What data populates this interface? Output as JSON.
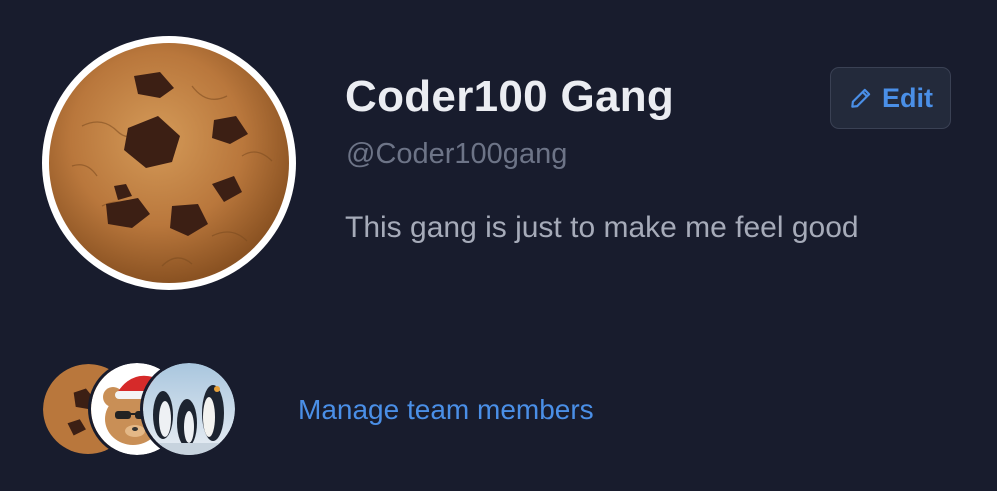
{
  "team": {
    "name": "Coder100 Gang",
    "handle": "@Coder100gang",
    "bio": "This gang is just to make me feel good",
    "avatar_icon": "cookie-image"
  },
  "edit_button": {
    "label": "Edit",
    "icon": "pencil-icon"
  },
  "members": [
    {
      "avatar": "cookie-image"
    },
    {
      "avatar": "bear-with-santa-hat-and-sunglasses-image"
    },
    {
      "avatar": "penguins-image"
    }
  ],
  "manage_link": {
    "label": "Manage team members"
  },
  "colors": {
    "background": "#181c2d",
    "accent": "#4a8fe7",
    "title": "#ebedf2",
    "muted": "#6d7487",
    "body_text": "#a6abb9"
  }
}
